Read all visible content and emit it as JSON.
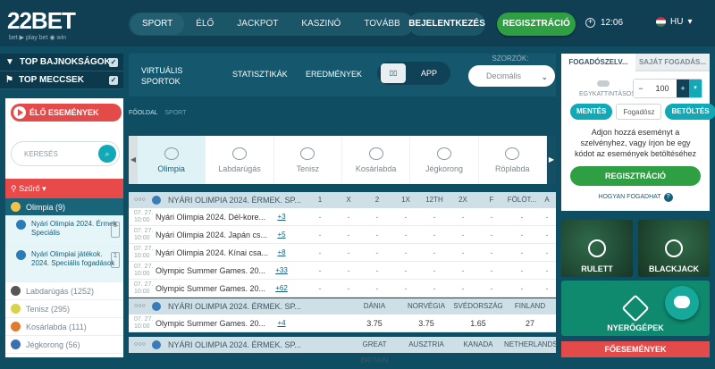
{
  "header": {
    "logo_big": "22BET",
    "logo_sub": "bet ▶ play  bet ◉ win",
    "nav": [
      "SPORT",
      "ÉLŐ",
      "JACKPOT",
      "KASZINÓ",
      "TOVÁBB"
    ],
    "login": "BEJELENTKEZÉS",
    "register": "REGISZTRÁCIÓ",
    "time": "12:06",
    "lang": "HU"
  },
  "left": {
    "top_leagues": "TOP BAJNOKSÁGOK",
    "top_matches": "TOP MECCSEK",
    "live_events": "ÉLŐ ESEMÉNYEK",
    "search_placeholder": "KERESÉS",
    "filter": "Szűrő",
    "sports": [
      {
        "label": "Olimpia (9)",
        "selected": true
      },
      {
        "label": "Nyári Olimpia 2024. Érmek. Speciális",
        "sub": true,
        "count": "8"
      },
      {
        "label": "Nyári Olimpiai játékok. 2024. Speciális fogadások",
        "sub": true,
        "count": "1"
      },
      {
        "label": "Labdarúgás (1252)"
      },
      {
        "label": "Tenisz (295)"
      },
      {
        "label": "Kosárlabda (111)"
      },
      {
        "label": "Jégkorong (56)"
      }
    ]
  },
  "main": {
    "virtual": "VIRTUÁLIS SPORTOK",
    "stats": "STATISZTIKÁK",
    "results": "EREDMÉNYEK",
    "app": "APP",
    "odds_label": "SZORZÓK:",
    "odds_format": "Decimális",
    "breadcrumb": [
      "FŐOLDAL",
      "SPORT"
    ],
    "sport_tabs": [
      "Olimpia",
      "Labdarúgás",
      "Tenisz",
      "Kosárlabda",
      "Jégkorong",
      "Röplabda"
    ],
    "table1": {
      "title": "NYÁRI OLIMPIA 2024. ÉRMEK. SP...",
      "cols": [
        "1",
        "X",
        "2",
        "1X",
        "12TH",
        "2X",
        "F",
        "FÖLÖT...",
        "A"
      ],
      "rows": [
        {
          "time": "07. 27.",
          "time2": "10:00",
          "name": "Nyári Olimpia 2024. Dél-kore...",
          "plus": "+3"
        },
        {
          "time": "07. 27.",
          "time2": "10:00",
          "name": "Nyári Olimpia 2024. Japán cs...",
          "plus": "+5"
        },
        {
          "time": "07. 27.",
          "time2": "10:00",
          "name": "Nyári Olimpia 2024. Kínai csa...",
          "plus": "+8"
        },
        {
          "time": "07. 27.",
          "time2": "10:00",
          "name": "Olympic Summer Games. 20...",
          "plus": "+33"
        },
        {
          "time": "07. 27.",
          "time2": "10:00",
          "name": "Olympic Summer Games. 20...",
          "plus": "+62"
        }
      ],
      "dash": "-"
    },
    "table2": {
      "title": "NYÁRI OLIMPIA 2024. ÉRMEK. SP...",
      "cols": [
        "DÁNIA",
        "NORVÉGIA",
        "SVÉDORSZÁG",
        "FINLAND"
      ],
      "row": {
        "time": "07. 27.",
        "time2": "10:00",
        "name": "Olympic Summer Games. 20...",
        "plus": "+4",
        "odds": [
          "3.75",
          "3.75",
          "1.65",
          "27"
        ]
      }
    },
    "table3": {
      "title": "NYÁRI OLIMPIA 2024. ÉRMEK. SP...",
      "cols": [
        "GREAT BRITAIN",
        "AUSZTRIA",
        "KANADA",
        "NETHERLANDS"
      ]
    }
  },
  "betslip": {
    "tab1": "FOGADÓSZELV...",
    "tab2": "SAJÁT FOGADÁS...",
    "egykattintasos": "EGYKATTINTÁSOS:",
    "stake": "100",
    "save": "MENTÉS",
    "code_placeholder": "Fogadósz",
    "load": "BETÖLTÉS",
    "message": "Adjon hozzá eseményt a szelvényhez, vagy írjon be egy kódot az események betöltéséhez",
    "register": "REGISZTRÁCIÓ",
    "how": "HOGYAN FOGADHAT"
  },
  "tiles": {
    "roulette": "RULETT",
    "blackjack": "BLACKJACK",
    "slots": "NYERŐGÉPEK"
  },
  "featured": "FŐESEMÉNYEK"
}
